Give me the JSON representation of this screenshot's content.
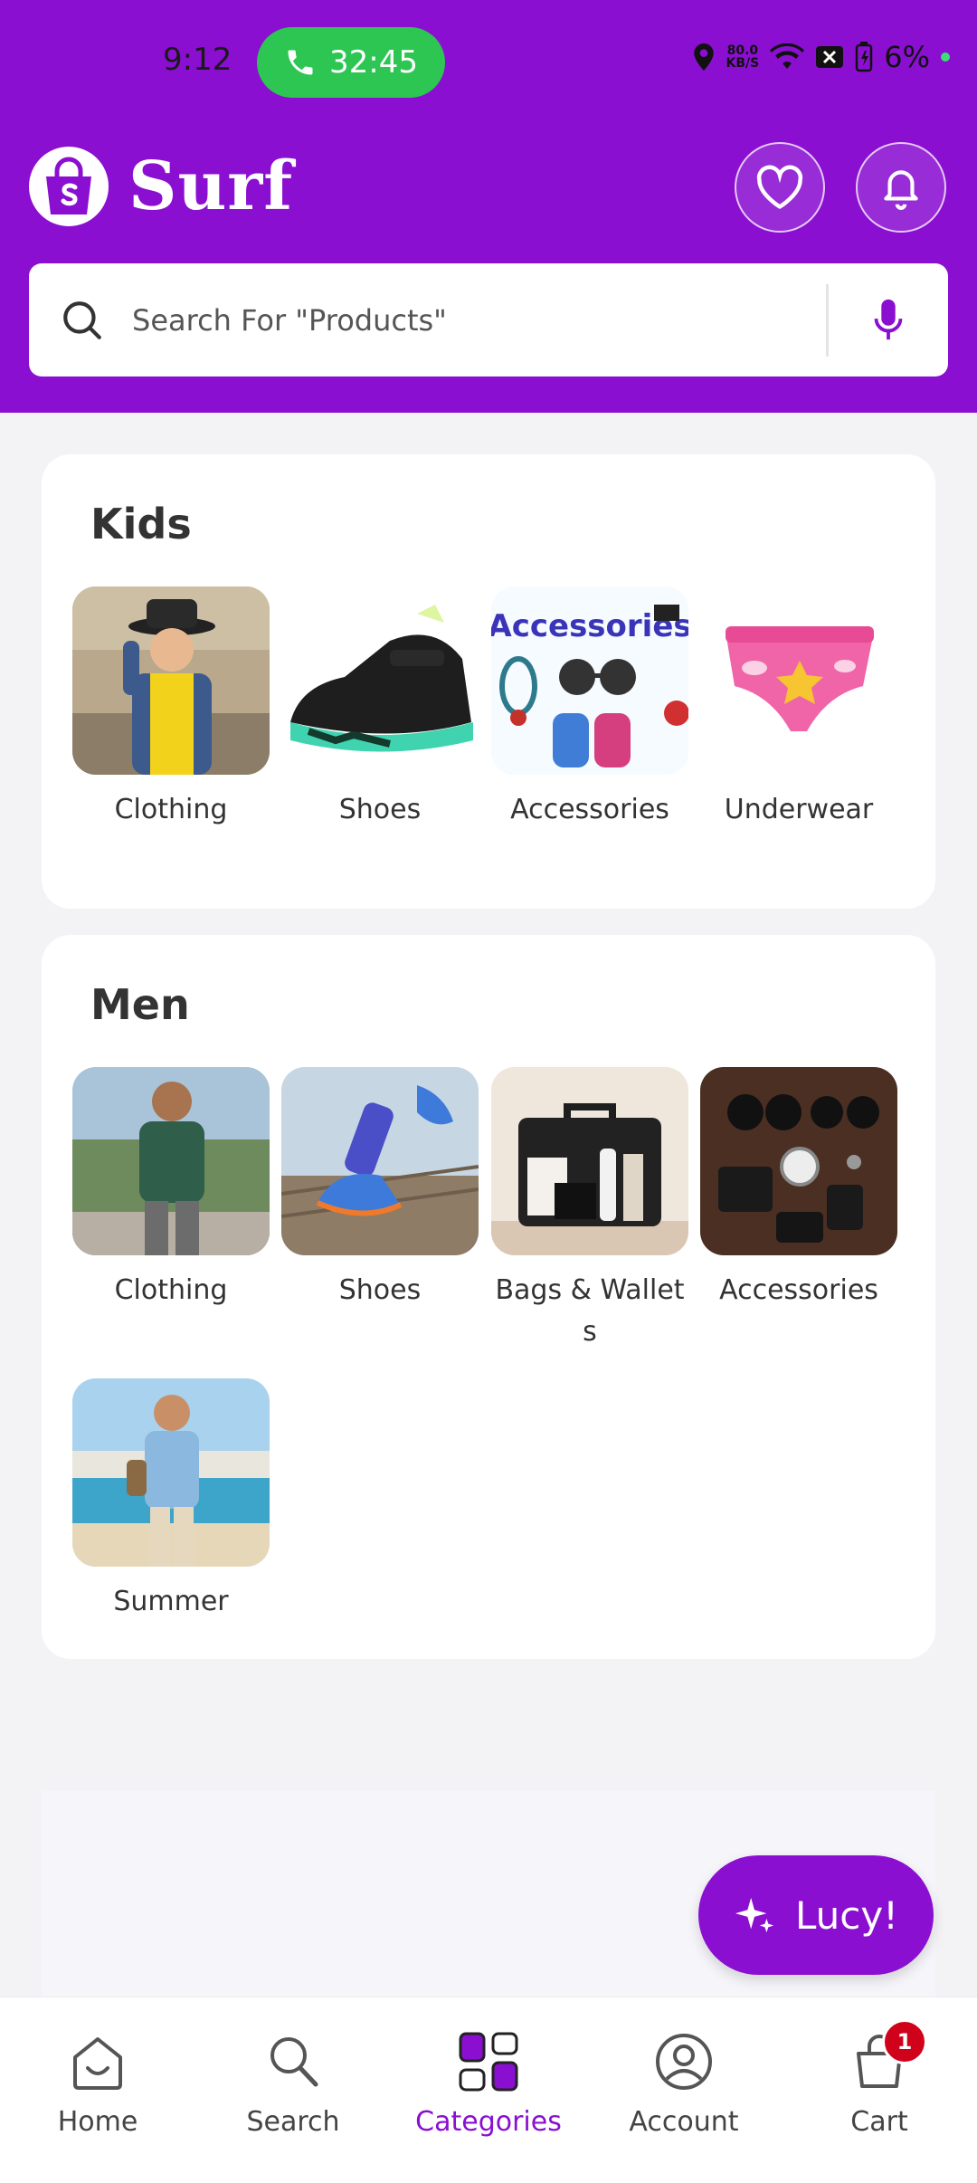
{
  "status_bar": {
    "time": "9:12",
    "call_timer": "32:45",
    "net_speed_value": "80.0",
    "net_speed_unit": "KB/S",
    "battery": "6%"
  },
  "brand": {
    "name": "Surf"
  },
  "search": {
    "placeholder": "Search For \"Products\""
  },
  "sections": [
    {
      "title": "Kids",
      "items": [
        {
          "label": "Clothing"
        },
        {
          "label": "Shoes"
        },
        {
          "label": "Accessories",
          "image_text": "Accessories"
        },
        {
          "label": "Underwear"
        }
      ]
    },
    {
      "title": "Men",
      "items": [
        {
          "label": "Clothing"
        },
        {
          "label": "Shoes"
        },
        {
          "label": "Bags & Wallets"
        },
        {
          "label": "Accessories"
        },
        {
          "label": "Summer"
        }
      ]
    }
  ],
  "fab": {
    "label": "Lucy!",
    "icon": "sparkle-icon"
  },
  "bottom_nav": [
    {
      "label": "Home",
      "icon": "home-icon"
    },
    {
      "label": "Search",
      "icon": "search-icon"
    },
    {
      "label": "Categories",
      "icon": "categories-icon",
      "active": true
    },
    {
      "label": "Account",
      "icon": "account-icon"
    },
    {
      "label": "Cart",
      "icon": "cart-icon",
      "badge": "1"
    }
  ],
  "colors": {
    "brand": "#8A0FD1",
    "call_green": "#2DC653",
    "badge_red": "#D0021B"
  }
}
